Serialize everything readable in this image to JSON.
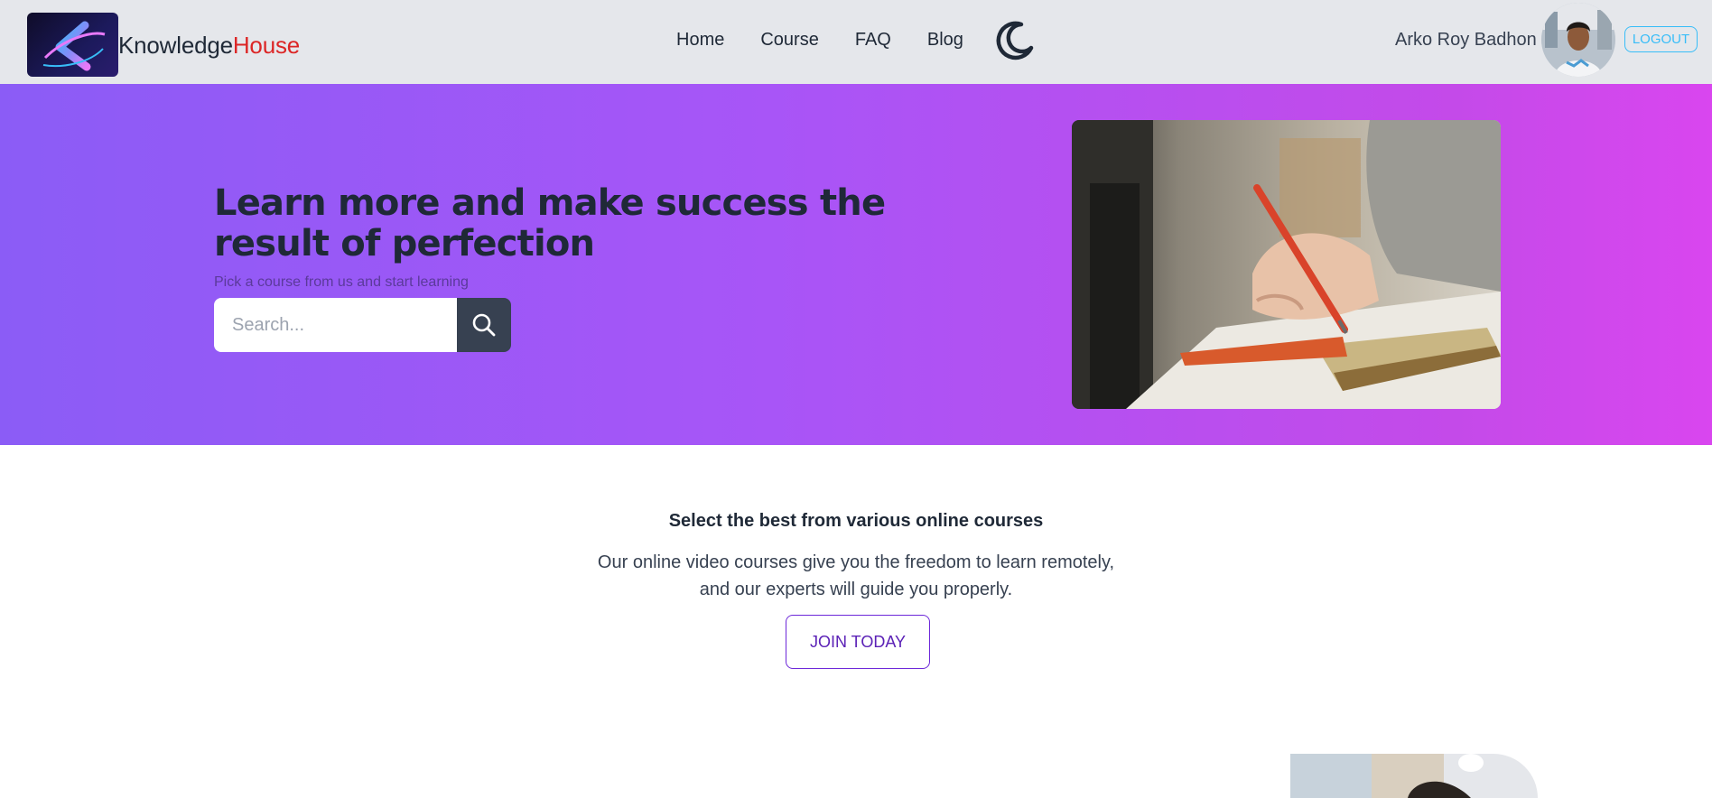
{
  "navbar": {
    "brand_part1": "Knowledge",
    "brand_part2": "House",
    "links": [
      {
        "label": "Home"
      },
      {
        "label": "Course"
      },
      {
        "label": "FAQ"
      },
      {
        "label": "Blog"
      }
    ],
    "theme_toggle_icon": "moon-icon",
    "user_name": "Arko Roy Badhon",
    "logout_label": "LOGOUT"
  },
  "hero": {
    "title": "Learn more and make success the result of perfection",
    "subtitle": "Pick a course from us and start learning",
    "search_placeholder": "Search...",
    "search_icon": "search-icon"
  },
  "info": {
    "title": "Select the best from various online courses",
    "text": "Our online video courses give you the freedom to learn remotely, and our experts will guide you properly.",
    "join_label": "JOIN TODAY"
  },
  "colors": {
    "brand_accent": "#dc2626",
    "hero_gradient_start": "#8b5cf6",
    "hero_gradient_end": "#d946ef",
    "logout_border": "#38bdf8",
    "join_border": "#6d28d9"
  }
}
